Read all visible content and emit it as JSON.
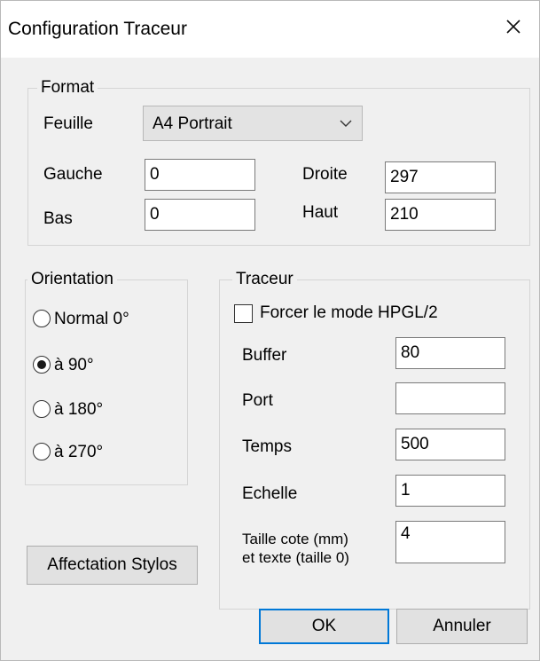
{
  "window": {
    "title": "Configuration Traceur",
    "close_icon": "close-icon"
  },
  "format": {
    "legend": "Format",
    "feuille_label": "Feuille",
    "feuille_value": "A4 Portrait",
    "gauche_label": "Gauche",
    "gauche_value": "0",
    "droite_label": "Droite",
    "droite_value": "297",
    "bas_label": "Bas",
    "bas_value": "0",
    "haut_label": "Haut",
    "haut_value": "210"
  },
  "orientation": {
    "legend": "Orientation",
    "options": [
      {
        "label": "Normal 0°",
        "selected": false
      },
      {
        "label": "à 90°",
        "selected": true
      },
      {
        "label": "à 180°",
        "selected": false
      },
      {
        "label": "à 270°",
        "selected": false
      }
    ]
  },
  "traceur": {
    "legend": "Traceur",
    "force_hpgl_label": "Forcer le mode HPGL/2",
    "force_hpgl_checked": false,
    "buffer_label": "Buffer",
    "buffer_value": "80",
    "port_label": "Port",
    "port_value": "",
    "temps_label": "Temps",
    "temps_value": "500",
    "echelle_label": "Echelle",
    "echelle_value": "1",
    "taille_label_line1": "Taille cote (mm)",
    "taille_label_line2": "et texte (taille 0)",
    "taille_value": "4"
  },
  "buttons": {
    "affectation": "Affectation Stylos",
    "ok": "OK",
    "annuler": "Annuler"
  }
}
